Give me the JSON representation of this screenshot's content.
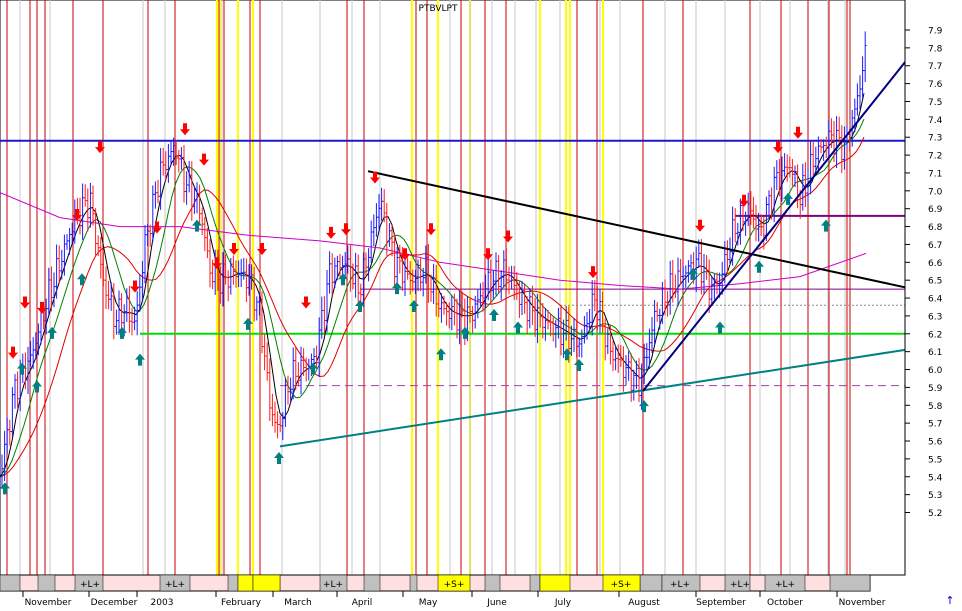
{
  "chart_data": {
    "type": "candlestick-line",
    "title": "PTBVLPT",
    "ylim": [
      5.1,
      8.0
    ],
    "y_ticks": [
      "7.9",
      "7.8",
      "7.7",
      "7.6",
      "7.5",
      "7.4",
      "7.3",
      "7.2",
      "7.1",
      "7.0",
      "6.9",
      "6.8",
      "6.7",
      "6.6",
      "6.5",
      "6.4",
      "6.3",
      "6.2",
      "6.1",
      "6.0",
      "5.9",
      "5.8",
      "5.7",
      "5.6",
      "5.5",
      "5.4",
      "5.3",
      "5.2"
    ],
    "x_labels": [
      "November",
      "December",
      "2003",
      "February",
      "March",
      "April",
      "May",
      "June",
      "July",
      "August",
      "September",
      "October",
      "November"
    ],
    "grid": true,
    "colors": {
      "price_up": "#1a1aff",
      "price_down": "#ff1a1a",
      "ma_short": "#000000",
      "ma_mid": "#008000",
      "ma_long": "#e00000",
      "ma_very_long": "#cc00cc",
      "resistance": "#0000aa",
      "support_green": "#00dd00",
      "support_purple": "#800080",
      "trend_teal": "#008080",
      "trend_black": "#000000",
      "trend_navy": "#000080",
      "buy_arrow": "#008080",
      "sell_arrow": "#ff0000",
      "highlight_yellow": "#ffff00",
      "band_gray": "#c0c0c0",
      "cycle_line": "#cc0000"
    },
    "horizontal_levels": [
      {
        "value": 7.28,
        "style": "blue"
      },
      {
        "value": 6.86,
        "style": "purple"
      },
      {
        "value": 6.45,
        "style": "purple-thin"
      },
      {
        "value": 6.36,
        "style": "dotted-gray"
      },
      {
        "value": 6.2,
        "style": "green"
      },
      {
        "value": 5.91,
        "style": "dashed-purple"
      }
    ],
    "trendlines": [
      {
        "style": "teal",
        "from": [
          280,
          5.57
        ],
        "to": [
          905,
          6.11
        ]
      },
      {
        "style": "black",
        "from": [
          368,
          7.11
        ],
        "to": [
          905,
          6.46
        ]
      },
      {
        "style": "navy",
        "from": [
          643,
          5.88
        ],
        "to": [
          905,
          7.72
        ]
      }
    ],
    "bottom_band_labels": [
      "+L+",
      "+L+",
      "+L+",
      "+S+",
      "+S+",
      "+L+",
      "+L+",
      "+L+"
    ],
    "corner_arrow": "↑"
  }
}
